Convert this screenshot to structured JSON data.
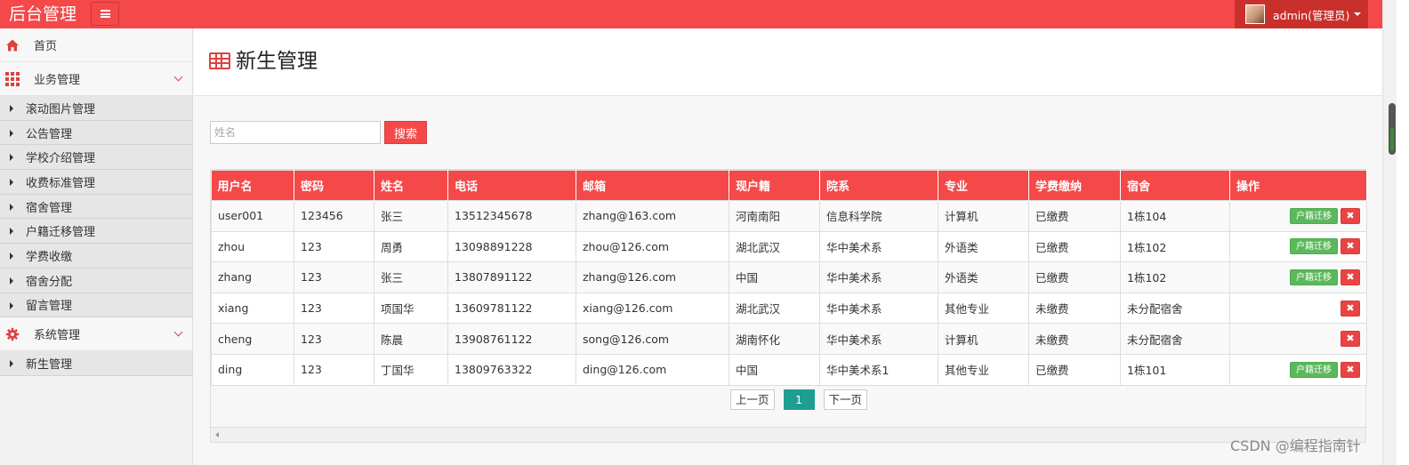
{
  "app": {
    "title": "后台管理"
  },
  "user": {
    "name": "admin(管理员)"
  },
  "sidebar": {
    "home": "首页",
    "business": {
      "label": "业务管理",
      "items": [
        "滚动图片管理",
        "公告管理",
        "学校介绍管理",
        "收费标准管理",
        "宿舍管理",
        "户籍迁移管理",
        "学费收缴",
        "宿舍分配",
        "留言管理"
      ]
    },
    "system": {
      "label": "系统管理",
      "items": [
        "新生管理"
      ]
    }
  },
  "page": {
    "title": "新生管理"
  },
  "search": {
    "placeholder": "姓名",
    "button": "搜索"
  },
  "table": {
    "columns": [
      "用户名",
      "密码",
      "姓名",
      "电话",
      "邮箱",
      "现户籍",
      "院系",
      "专业",
      "学费缴纳",
      "宿舍",
      "操作"
    ],
    "rows": [
      [
        "user001",
        "123456",
        "张三",
        "13512345678",
        "zhang@163.com",
        "河南南阳",
        "信息科学院",
        "计算机",
        "已缴费",
        "1栋104"
      ],
      [
        "zhou",
        "123",
        "周勇",
        "13098891228",
        "zhou@126.com",
        "湖北武汉",
        "华中美术系",
        "外语类",
        "已缴费",
        "1栋102"
      ],
      [
        "zhang",
        "123",
        "张三",
        "13807891122",
        "zhang@126.com",
        "中国",
        "华中美术系",
        "外语类",
        "已缴费",
        "1栋102"
      ],
      [
        "xiang",
        "123",
        "项国华",
        "13609781122",
        "xiang@126.com",
        "湖北武汉",
        "华中美术系",
        "其他专业",
        "未缴费",
        "未分配宿舍"
      ],
      [
        "cheng",
        "123",
        "陈晨",
        "13908761122",
        "song@126.com",
        "湖南怀化",
        "华中美术系",
        "计算机",
        "未缴费",
        "未分配宿舍"
      ],
      [
        "ding",
        "123",
        "丁国华",
        "13809763322",
        "ding@126.com",
        "中国",
        "华中美术系1",
        "其他专业",
        "已缴费",
        "1栋101"
      ]
    ],
    "row_has_move": [
      true,
      true,
      true,
      false,
      false,
      true
    ],
    "move_label": "户籍迁移",
    "delete_label": "✖"
  },
  "pagination": {
    "prev": "上一页",
    "current": "1",
    "next": "下一页"
  },
  "watermark": "CSDN @编程指南针",
  "colors": {
    "accent": "#f54849",
    "accent_dark": "#c9302c",
    "success": "#5cb85c",
    "pager_active": "#1e9e92"
  }
}
